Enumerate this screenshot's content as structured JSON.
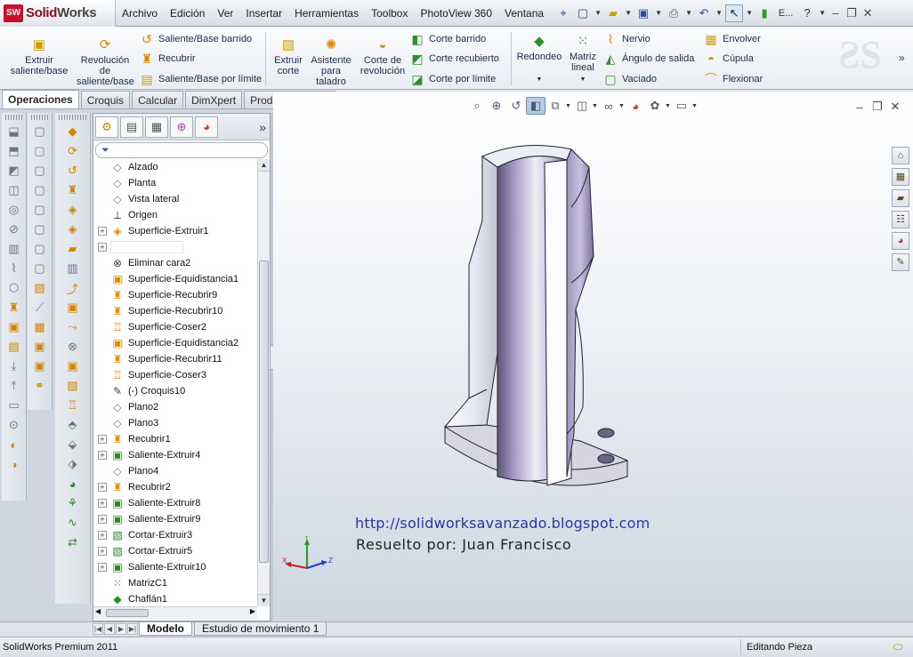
{
  "app": {
    "brand_prefix": "Solid",
    "brand_suffix": "Works",
    "logo_badge": "SW"
  },
  "menu": [
    "Archivo",
    "Edición",
    "Ver",
    "Insertar",
    "Herramientas",
    "Toolbox",
    "PhotoView 360",
    "Ventana"
  ],
  "quick_access": {
    "edit_label": "E..."
  },
  "ribbon": {
    "extrude_boss": "Extruir saliente/base",
    "revolve_boss": "Revolución de saliente/base",
    "swept_boss": "Saliente/Base barrido",
    "loft": "Recubrir",
    "boundary_boss": "Saliente/Base por límite",
    "extrude_cut": "Extruir corte",
    "hole_wizard": "Asistente para taladro",
    "revolve_cut": "Corte de revolución",
    "swept_cut": "Corte barrido",
    "lofted_cut": "Corte recubierto",
    "boundary_cut": "Corte por límite",
    "fillet": "Redondeo",
    "linear_pattern": "Matriz lineal",
    "rib": "Nervio",
    "draft": "Ángulo de salida",
    "shell": "Vaciado",
    "wrap": "Envolver",
    "dome": "Cúpula",
    "flex": "Flexionar"
  },
  "command_tabs": [
    "Operaciones",
    "Croquis",
    "Calcular",
    "DimXpert",
    "Productos Office"
  ],
  "active_command_tab": "Operaciones",
  "feature_tree": [
    {
      "label": "Alzado",
      "icon": "plane",
      "expandable": false
    },
    {
      "label": "Planta",
      "icon": "plane",
      "expandable": false
    },
    {
      "label": "Vista lateral",
      "icon": "plane",
      "expandable": false
    },
    {
      "label": "Origen",
      "icon": "origin",
      "expandable": false
    },
    {
      "label": "Superficie-Extruir1",
      "icon": "surface",
      "expandable": true
    },
    {
      "label": "",
      "icon": "none",
      "expandable": true,
      "editing": true
    },
    {
      "label": "Eliminar cara2",
      "icon": "delete-face",
      "expandable": false
    },
    {
      "label": "Superficie-Equidistancia1",
      "icon": "offset",
      "expandable": false
    },
    {
      "label": "Superficie-Recubrir9",
      "icon": "loft",
      "expandable": false
    },
    {
      "label": "Superficie-Recubrir10",
      "icon": "loft",
      "expandable": false
    },
    {
      "label": "Superficie-Coser2",
      "icon": "knit",
      "expandable": false
    },
    {
      "label": "Superficie-Equidistancia2",
      "icon": "offset",
      "expandable": false
    },
    {
      "label": "Superficie-Recubrir11",
      "icon": "loft",
      "expandable": false
    },
    {
      "label": "Superficie-Coser3",
      "icon": "knit",
      "expandable": false
    },
    {
      "label": "(-) Croquis10",
      "icon": "sketch",
      "expandable": false
    },
    {
      "label": "Plano2",
      "icon": "plane",
      "expandable": false
    },
    {
      "label": "Plano3",
      "icon": "plane",
      "expandable": false
    },
    {
      "label": "Recubrir1",
      "icon": "loft",
      "expandable": true
    },
    {
      "label": "Saliente-Extruir4",
      "icon": "boss",
      "expandable": true
    },
    {
      "label": "Plano4",
      "icon": "plane",
      "expandable": false
    },
    {
      "label": "Recubrir2",
      "icon": "loft",
      "expandable": true
    },
    {
      "label": "Saliente-Extruir8",
      "icon": "boss",
      "expandable": true
    },
    {
      "label": "Saliente-Extruir9",
      "icon": "boss",
      "expandable": true
    },
    {
      "label": "Cortar-Extruir3",
      "icon": "cut",
      "expandable": true
    },
    {
      "label": "Cortar-Extruir5",
      "icon": "cut",
      "expandable": true
    },
    {
      "label": "Saliente-Extruir10",
      "icon": "boss",
      "expandable": true
    },
    {
      "label": "MatrizC1",
      "icon": "pattern",
      "expandable": false
    },
    {
      "label": "Chaflán1",
      "icon": "chamfer",
      "expandable": false
    }
  ],
  "graphics": {
    "blog_url": "http://solidworksavanzado.blogspot.com",
    "author": "Resuelto por: Juan Francisco",
    "triad": {
      "x": "X",
      "y": "Y",
      "z": "Z"
    }
  },
  "bottom_tabs": [
    "Modelo",
    "Estudio de movimiento 1"
  ],
  "active_bottom_tab": "Modelo",
  "status": {
    "product": "SolidWorks Premium 2011",
    "mode": "Editando Pieza"
  },
  "colors": {
    "accent_red": "#c8102e",
    "feature_orange": "#e08a00",
    "link_blue": "#2536a8",
    "part_purple": "#a49ac4"
  }
}
